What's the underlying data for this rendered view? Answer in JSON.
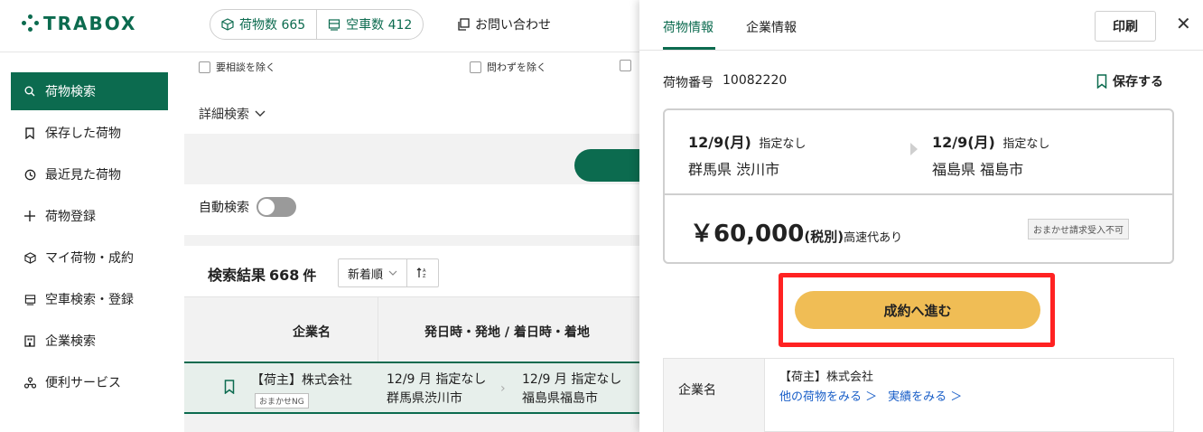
{
  "header": {
    "logo_text": "TRABOX",
    "cargo_count_label": "荷物数 665",
    "truck_count_label": "空車数 412",
    "inquiry_label": "お問い合わせ"
  },
  "sidebar": {
    "items": [
      {
        "label": "荷物検索",
        "icon": "search-icon"
      },
      {
        "label": "保存した荷物",
        "icon": "bookmark-icon"
      },
      {
        "label": "最近見た荷物",
        "icon": "clock-icon"
      },
      {
        "label": "荷物登録",
        "icon": "plus-icon"
      },
      {
        "label": "マイ荷物・成約",
        "icon": "box-icon"
      },
      {
        "label": "空車検索・登録",
        "icon": "truck-icon"
      },
      {
        "label": "企業検索",
        "icon": "building-icon"
      },
      {
        "label": "便利サービス",
        "icon": "service-icon"
      }
    ]
  },
  "filters": {
    "opt1": "要相談を除く",
    "opt2": "問わずを除く",
    "detail_search": "詳細検索",
    "auto_search": "自動検索"
  },
  "results": {
    "label": "検索結果",
    "count": "668",
    "unit": "件",
    "sort_label": "新着順",
    "sort_order_icon": "sort-az-icon"
  },
  "table": {
    "col_company": "企業名",
    "col_route": "発日時・発地 / 着日時・着地",
    "row": {
      "company": "【荷主】株式会社",
      "tag": "おまかせNG",
      "dep_date": "12/9 月 指定なし",
      "dep_place": "群馬県渋川市",
      "arr_date": "12/9 月 指定なし",
      "arr_place": "福島県福島市"
    }
  },
  "drawer": {
    "tab_cargo": "荷物情報",
    "tab_company": "企業情報",
    "print_label": "印刷",
    "cargo_no_label": "荷物番号",
    "cargo_no": "10082220",
    "save_label": "保存する",
    "dep_date": "12/9(月)",
    "dep_time": "指定なし",
    "dep_place": "群馬県 渋川市",
    "arr_date": "12/9(月)",
    "arr_time": "指定なし",
    "arr_place": "福島県 福島市",
    "price": "￥60,000",
    "price_tax": "(税別)",
    "highway": "高速代あり",
    "price_tag": "おまかせ請求受入不可",
    "cta_label": "成約へ進む",
    "company_head": "企業名",
    "company_name": "【荷主】株式会社",
    "link_other": "他の荷物をみる ＞",
    "link_record": "実績をみる ＞"
  },
  "colors": {
    "brand_green": "#0c6b4f",
    "cta_yellow": "#f0bd55",
    "highlight_red": "#ff2222",
    "link_blue": "#1a5fc8"
  }
}
